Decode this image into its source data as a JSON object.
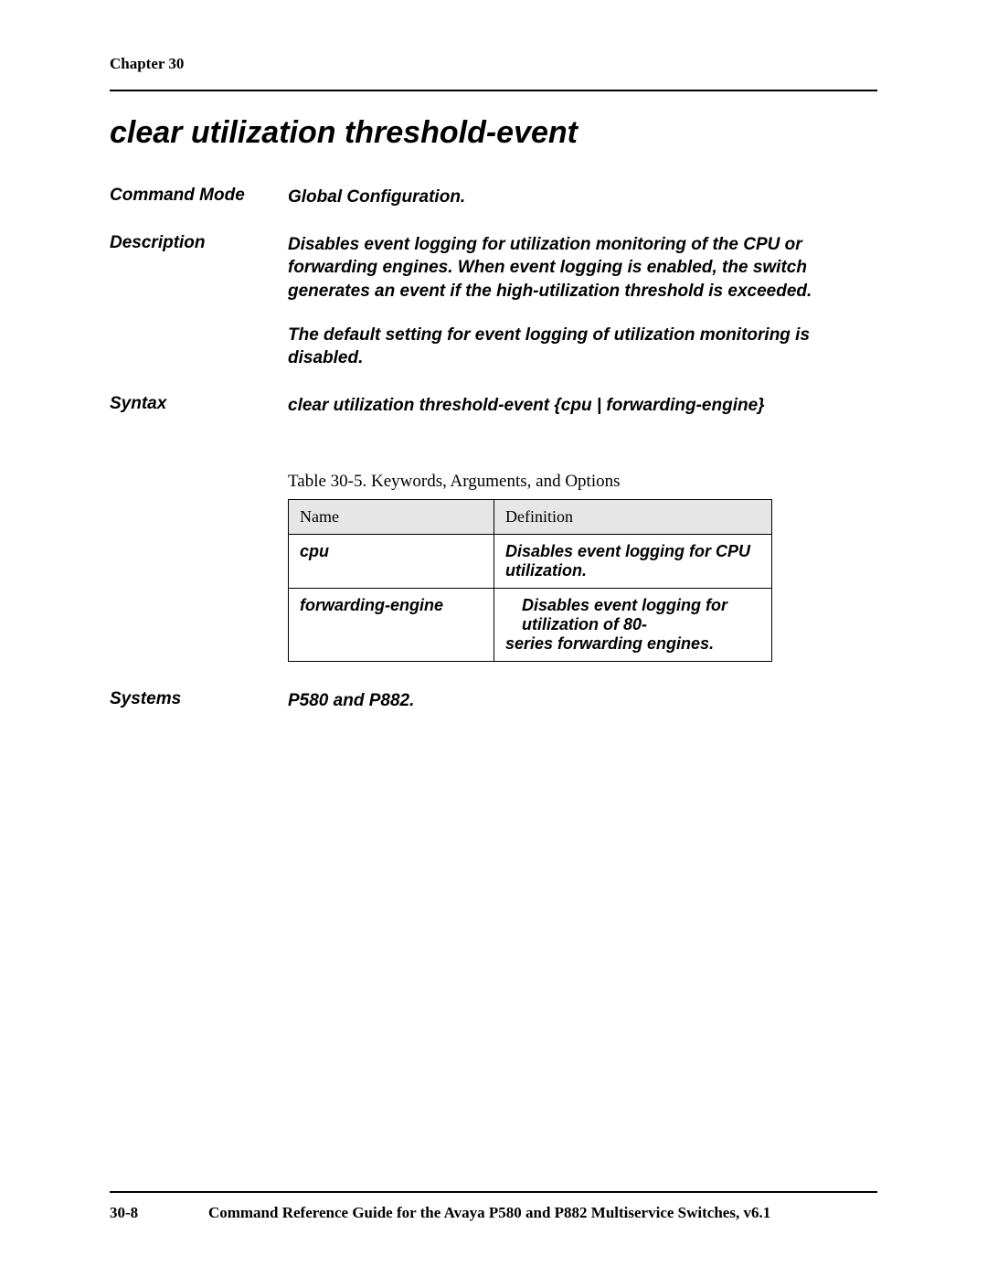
{
  "header": {
    "chapter": "Chapter 30"
  },
  "title": "clear utilization threshold-event",
  "rows": {
    "command_mode": {
      "label": "Command Mode",
      "value": "Global Configuration."
    },
    "description": {
      "label": "Description",
      "p1": "Disables event logging for utilization monitoring of the CPU or forwarding engines. When event logging is enabled, the switch generates an event if the high-utilization threshold is exceeded.",
      "p2": "The default setting for event logging of utilization monitoring is disabled."
    },
    "syntax": {
      "label": "Syntax",
      "value": "clear utilization threshold-event {cpu | forwarding-engine}"
    },
    "systems": {
      "label": "Systems",
      "value": "P580 and P882."
    }
  },
  "table": {
    "caption": "Table 30-5.  Keywords, Arguments, and Options",
    "headers": {
      "name": "Name",
      "definition": "Definition"
    },
    "rows": [
      {
        "name": "cpu",
        "definition": "Disables event logging for CPU utilization."
      },
      {
        "name": "forwarding-engine",
        "definition_line1": "Disables event logging for utilization of 80-",
        "definition_line2": "series forwarding engines."
      }
    ]
  },
  "footer": {
    "page": "30-8",
    "book": "Command Reference Guide for the Avaya P580 and P882 Multiservice Switches, v6.1"
  }
}
